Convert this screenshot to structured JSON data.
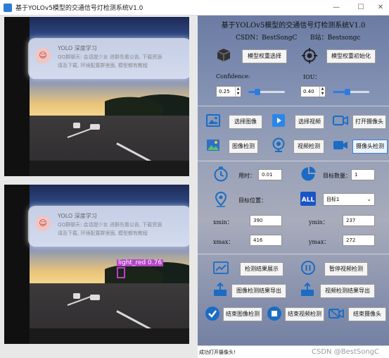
{
  "window": {
    "title": "基于YOLOv5模型的交通信号灯检测系统V1.0"
  },
  "video_top": {
    "notification": {
      "title": "YOLO 深度学习",
      "line1": "QQ群聊天: 会话提少女 进群先看公告, 下载资源",
      "line2": "请及下载, 环境配置群里面, 模型都有教程"
    }
  },
  "video_bottom": {
    "notification": {
      "title": "YOLO 深度学习",
      "line1": "QQ群聊天: 会话提少女 进群先看公告, 下载资源",
      "line2": "请及下载, 环境配置群里面, 模型都有教程"
    },
    "detection": {
      "label": "light_red  0.76"
    }
  },
  "panel": {
    "title": "基于YOLOv5模型的交通信号灯检测系统V1.0",
    "csdn": "CSDN：BestSongC",
    "bili": "B站：Bestsongc",
    "model_select": "模型权重选择",
    "model_init": "模型权重初始化",
    "confidence_label": "Confidence:",
    "confidence_value": "0.25",
    "confidence_level": 0.25,
    "iou_label": "IOU：",
    "iou_value": "0.40",
    "iou_level": 0.4,
    "select_image": "选择图像",
    "select_video": "选择视频",
    "open_camera": "打开摄像头",
    "detect_image": "图像检测",
    "detect_video": "视频检测",
    "detect_camera": "摄像头检测",
    "time_label": "用时：",
    "time_value": "0.01",
    "count_label": "目标数量：",
    "count_value": "1",
    "position_label": "目标位置：",
    "target_select": "目标1",
    "xmin_label": "xmin：",
    "xmin_value": "390",
    "ymin_label": "ymin：",
    "ymin_value": "237",
    "xmax_label": "xmax：",
    "xmax_value": "416",
    "ymax_label": "ymax：",
    "ymax_value": "272",
    "show_results": "检测结果展示",
    "pause_video": "暂停视频检测",
    "export_image": "图像检测结果导出",
    "export_video": "视频检测结果导出",
    "end_image": "结束图像检测",
    "end_video": "结束视频检测",
    "end_camera": "结束摄像头",
    "status_message": "成功打开摄像头!",
    "watermark": "CSDN @BestSongC"
  },
  "colors": {
    "accent": "#2e7be0",
    "detection_box": "#c03bd0"
  }
}
